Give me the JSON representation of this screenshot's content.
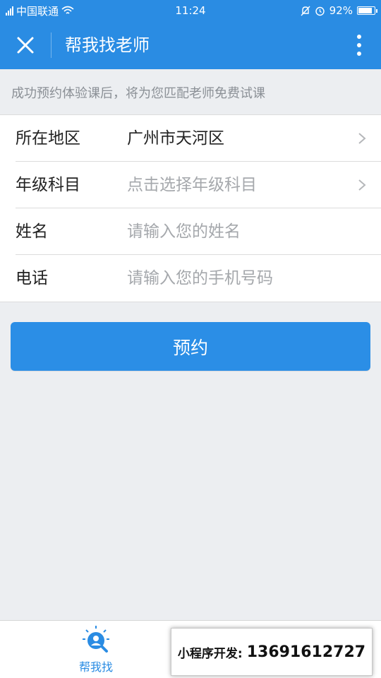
{
  "status_bar": {
    "carrier": "中国联通",
    "time": "11:24",
    "battery": "92%",
    "battery_level": 0.92
  },
  "nav": {
    "title": "帮我找老师",
    "close_icon": "close-icon",
    "more_icon": "more-vertical-icon"
  },
  "hint": "成功预约体验课后，将为您匹配老师免费试课",
  "form": {
    "region": {
      "label": "所在地区",
      "value": "广州市天河区"
    },
    "grade_subject": {
      "label": "年级科目",
      "placeholder": "点击选择年级科目"
    },
    "name": {
      "label": "姓名",
      "placeholder": "请输入您的姓名",
      "value": ""
    },
    "phone": {
      "label": "电话",
      "placeholder": "请输入您的手机号码",
      "value": ""
    }
  },
  "submit_label": "预约",
  "tab_bar": {
    "items": [
      {
        "label": "帮我找",
        "icon": "find-teacher-icon"
      }
    ]
  },
  "promo": {
    "label": "小程序开发:",
    "number": "13691612727"
  },
  "colors": {
    "primary": "#2a8ce3",
    "background": "#eceef1",
    "placeholder": "#a5a8ac"
  }
}
